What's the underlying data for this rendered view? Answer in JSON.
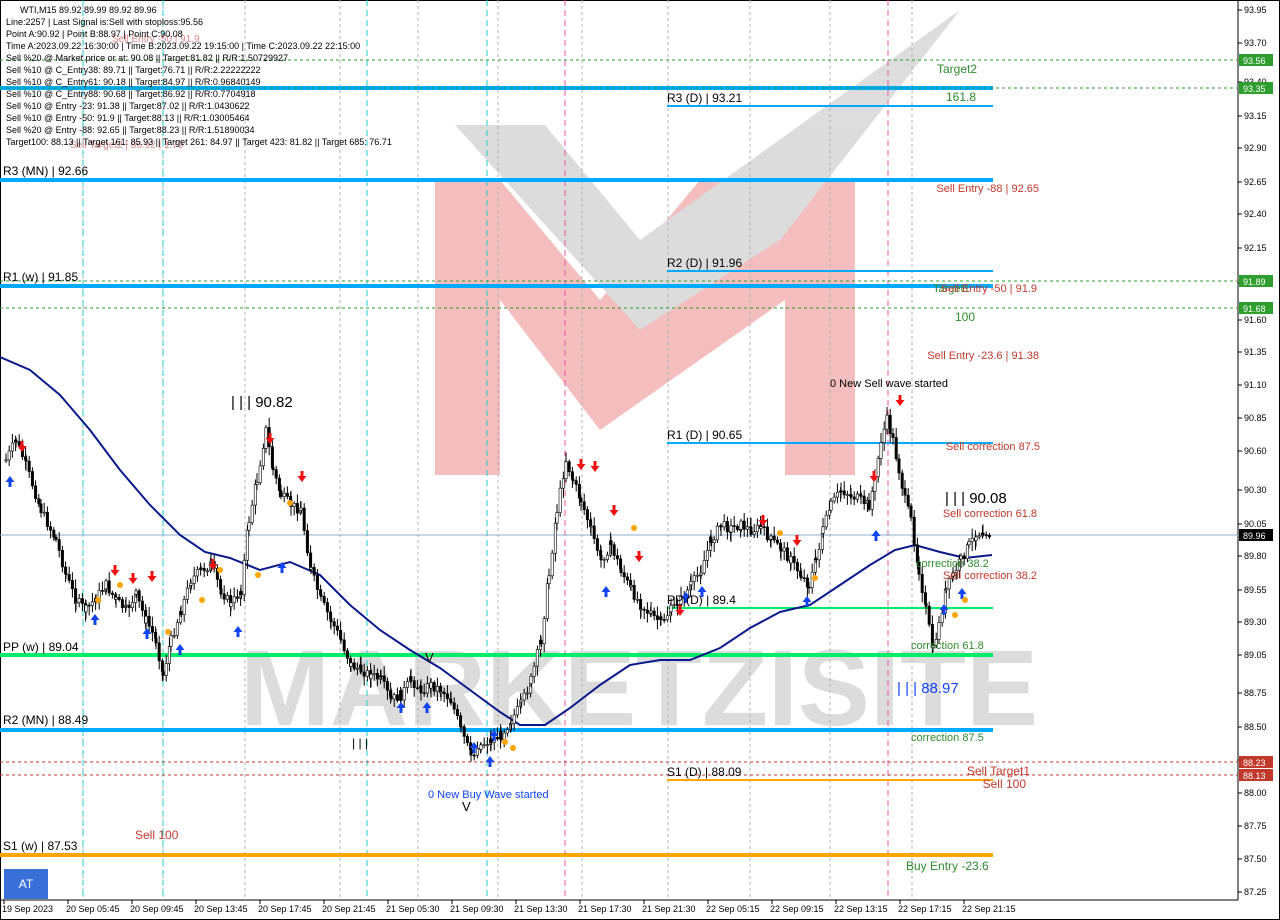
{
  "header": {
    "symbol_line": "WTI,M15   89.92 89.99 89.92 89.96",
    "lines": [
      "Line:2257  |  Last Signal is:Sell with stoploss:95.56",
      "Point A:90.92  |  Point B:88.97  |  Point C:90.08",
      "Time A:2023.09.22 16:30:00  |  Time B:2023.09.22 19:15:00  |  Time C:2023.09.22 22:15:00",
      "Sell %20 @ Market price or at: 90.08  ||  Target:81.82  ||  R/R:1.50729927",
      "Sell %10 @ C_Entry38: 89.71  ||  Target:76.71  ||  R/R:2.22222222",
      "Sell %10 @ C_Entry61: 90.18  ||  Target:84.97  ||  R/R:0.96840149",
      "Sell %10 @ C_Entry88: 90.68  ||  Target:86.92  ||  R/R:0.7704918",
      "Sell %10 @ Entry -23: 91.38  ||  Target:87.02  ||  R/R:1.0430622",
      "Sell %10 @ Entry -50: 91.9  ||  Target:88.13  ||  R/R:1.03005464",
      "Sell %20 @ Entry -88: 92.65  ||  Target:88.23  ||  R/R:1.51890034",
      "Target100: 88.13  ||  Target 161: 85.93  ||  Target 261: 84.97  ||  Target 423: 81.82  ||  Target 685: 76.71"
    ]
  },
  "price_axis": {
    "ticks": [
      "93.95",
      "93.70",
      "93.40",
      "93.15",
      "92.90",
      "92.65",
      "92.40",
      "92.15",
      "91.85",
      "91.60",
      "91.35",
      "91.10",
      "90.85",
      "90.60",
      "90.30",
      "90.05",
      "89.80",
      "89.55",
      "89.30",
      "89.05",
      "88.75",
      "88.50",
      "88.25",
      "88.00",
      "87.75",
      "87.50",
      "87.25"
    ],
    "current_price": "89.96",
    "badges": [
      {
        "label": "93.56",
        "color": "#2e9e2e"
      },
      {
        "label": "93.35",
        "color": "#2e9e2e"
      },
      {
        "label": "91.89",
        "color": "#2e9e2e"
      },
      {
        "label": "91.68",
        "color": "#2e9e2e"
      },
      {
        "label": "88.23",
        "color": "#c0392b"
      },
      {
        "label": "88.13",
        "color": "#c0392b"
      },
      {
        "label": "89.96",
        "color": "#000000"
      }
    ]
  },
  "time_axis": {
    "ticks": [
      "19 Sep 2023",
      "20 Sep 05:45",
      "20 Sep 09:45",
      "20 Sep 13:45",
      "20 Sep 17:45",
      "20 Sep 21:45",
      "21 Sep 05:30",
      "21 Sep 09:30",
      "21 Sep 13:30",
      "21 Sep 17:30",
      "21 Sep 21:30",
      "22 Sep 05:15",
      "22 Sep 09:15",
      "22 Sep 13:15",
      "22 Sep 17:15",
      "22 Sep 21:15"
    ]
  },
  "pivot_labels": {
    "r3_mn": "R3 (MN) | 92.66",
    "r1_w": "R1 (w) | 91.85",
    "pp_w": "PP (w) | 89.04",
    "r2_mn": "R2 (MN) | 88.49",
    "s1_w": "S1 (w) | 87.53",
    "r3_d": "R3 (D) | 93.21",
    "r2_d": "R2 (D) | 91.96",
    "r1_d": "R1 (D) | 90.65",
    "pp_d": "PP (D) | 89.4",
    "s1_d": "S1 (D) | 88.09"
  },
  "annotations": {
    "target2": "Target2",
    "fib_161": "161.8",
    "sell_entry_88": "Sell Entry -88 | 92.65",
    "target1": "Target1",
    "sell_entry_50": "Sell Entry -50 | 91.9",
    "fib_100": "100",
    "sell_entry_23": "Sell Entry -23.6 | 91.38",
    "new_sell_wave": "0 New Sell wave started",
    "sell_corr_875": "Sell correction 87.5",
    "point_c": "| | | 90.08",
    "sell_corr_618": "Sell correction 61.8",
    "corr_382_green": "correction 38.2",
    "sell_corr_382": "Sell correction 38.2",
    "corr_618_green": "correction 61.8",
    "point_b": "| | | 88.97",
    "corr_875_green": "correction 87.5",
    "sell_target1": "Sell Target1",
    "sell_100_right": "Sell 100",
    "buy_entry": "Buy Entry -23.6",
    "high_9082": "| | | 90.82",
    "marker_v": "V",
    "marker_iii": "| | |",
    "new_buy_wave": "0 New Buy Wave started",
    "sell_100_left": "Sell 100",
    "faded_sell_entry": "Sell Entry -50 | 91.9",
    "faded_sell_target": "Sell Target2 | 86.92 | 1.79"
  },
  "watermark": "MARKETZISITE",
  "at_button": "AT",
  "colors": {
    "pivot_blue": "#00aaff",
    "pp_green": "#00ee66",
    "s1_orange": "#ffa500",
    "ma_navy": "#0a1a8a",
    "sell_red": "#c0392b",
    "target_green": "#2e8b2e",
    "arrow_red": "#ee1111",
    "arrow_blue": "#1144ee"
  }
}
